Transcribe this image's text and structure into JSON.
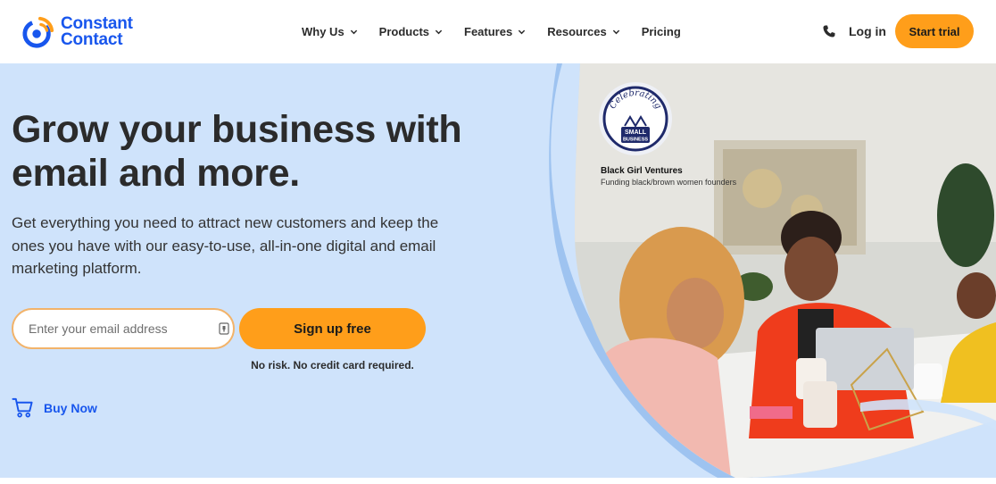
{
  "brand": {
    "name_line1": "Constant",
    "name_line2": "Contact",
    "color": "#1856ed"
  },
  "nav": {
    "items": [
      {
        "label": "Why Us",
        "dropdown": true
      },
      {
        "label": "Products",
        "dropdown": true
      },
      {
        "label": "Features",
        "dropdown": true
      },
      {
        "label": "Resources",
        "dropdown": true
      },
      {
        "label": "Pricing",
        "dropdown": false
      }
    ],
    "login_label": "Log in",
    "start_trial_label": "Start trial"
  },
  "hero": {
    "title": "Grow your business with email and more.",
    "subtitle": "Get everything you need to attract new customers and keep the ones you have with our easy-to-use, all-in-one digital and email marketing platform.",
    "email_placeholder": "Enter your email address",
    "signup_label": "Sign up free",
    "disclaimer": "No risk. No credit card required.",
    "buy_now_label": "Buy Now"
  },
  "badge": {
    "arc_text": "Celebrating",
    "label_line1": "SMALL",
    "label_line2": "BUSINESS",
    "business_name": "Black Girl Ventures",
    "business_desc": "Funding black/brown women founders"
  },
  "icons": {
    "logo": "constant-contact-logo-icon",
    "chevron": "chevron-down-icon",
    "phone": "phone-icon",
    "field": "password-manager-icon",
    "cart": "cart-icon"
  },
  "colors": {
    "accent": "#ff9e1a",
    "hero_bg": "#cfe3fb",
    "link": "#1856ed"
  }
}
